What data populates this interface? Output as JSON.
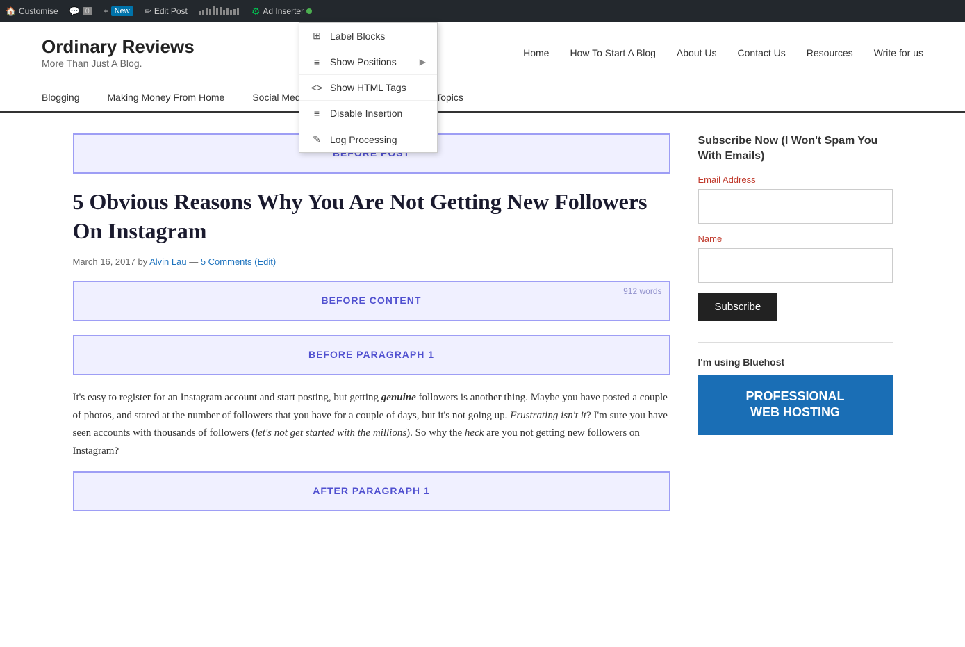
{
  "adminBar": {
    "customize": "Customise",
    "comments": "0",
    "new_label": "New",
    "edit_post": "Edit Post",
    "stats_label": "Stats",
    "ad_inserter": "Ad Inserter"
  },
  "dropdown": {
    "items": [
      {
        "id": "label-blocks",
        "label": "Label Blocks",
        "icon": "≡",
        "hasArrow": false
      },
      {
        "id": "show-positions",
        "label": "Show Positions",
        "icon": "≡",
        "hasArrow": true
      },
      {
        "id": "show-html-tags",
        "label": "Show HTML Tags",
        "icon": "<>",
        "hasArrow": false
      },
      {
        "id": "disable-insertion",
        "label": "Disable Insertion",
        "icon": "≡",
        "hasArrow": false
      },
      {
        "id": "log-processing",
        "label": "Log Processing",
        "icon": "✎",
        "hasArrow": false
      }
    ]
  },
  "header": {
    "site_title": "Ordinary Reviews",
    "site_tagline": "More Than Just A Blog.",
    "nav": [
      {
        "id": "home",
        "label": "Home"
      },
      {
        "id": "how-to-start",
        "label": "How To Start A Blog"
      },
      {
        "id": "about-us",
        "label": "About Us"
      },
      {
        "id": "contact-us",
        "label": "Contact Us"
      },
      {
        "id": "resources",
        "label": "Resources"
      },
      {
        "id": "write-for-us",
        "label": "Write for us"
      }
    ]
  },
  "secondaryNav": [
    {
      "id": "blogging",
      "label": "Blogging"
    },
    {
      "id": "making-money",
      "label": "Making Money From Home"
    },
    {
      "id": "social-media",
      "label": "Social Media Experiment"
    },
    {
      "id": "interesting-topics",
      "label": "Interesting Topics"
    }
  ],
  "content": {
    "before_post_label": "BEFORE POST",
    "article_title": "5 Obvious Reasons Why You Are Not Getting New Followers On Instagram",
    "article_meta": {
      "date": "March 16, 2017",
      "author": "Alvin Lau",
      "comments": "5 Comments",
      "edit": "(Edit)"
    },
    "before_content_label": "BEFORE CONTENT",
    "word_count": "912 words",
    "before_paragraph1_label": "BEFORE PARAGRAPH 1",
    "body_text": "It's easy to register for an Instagram account and start posting, but getting genuine followers is another thing. Maybe you have posted a couple of photos, and stared at the number of followers that you have for a couple of days, but it's not going up. Frustrating isn't it? I'm sure you have seen accounts with thousands of followers (let's not get started with the millions). So why the heck are you not getting new followers on Instagram?",
    "after_paragraph1_label": "AFTER PARAGRAPH 1"
  },
  "sidebar": {
    "subscribe_title": "Subscribe Now (I Won't Spam You With Emails)",
    "email_label": "Email Address",
    "name_label": "Name",
    "subscribe_btn": "Subscribe",
    "bluehost_label": "I'm using Bluehost",
    "bluehost_banner_text": "PROFESSIONAL\nWEB HOSTING"
  }
}
